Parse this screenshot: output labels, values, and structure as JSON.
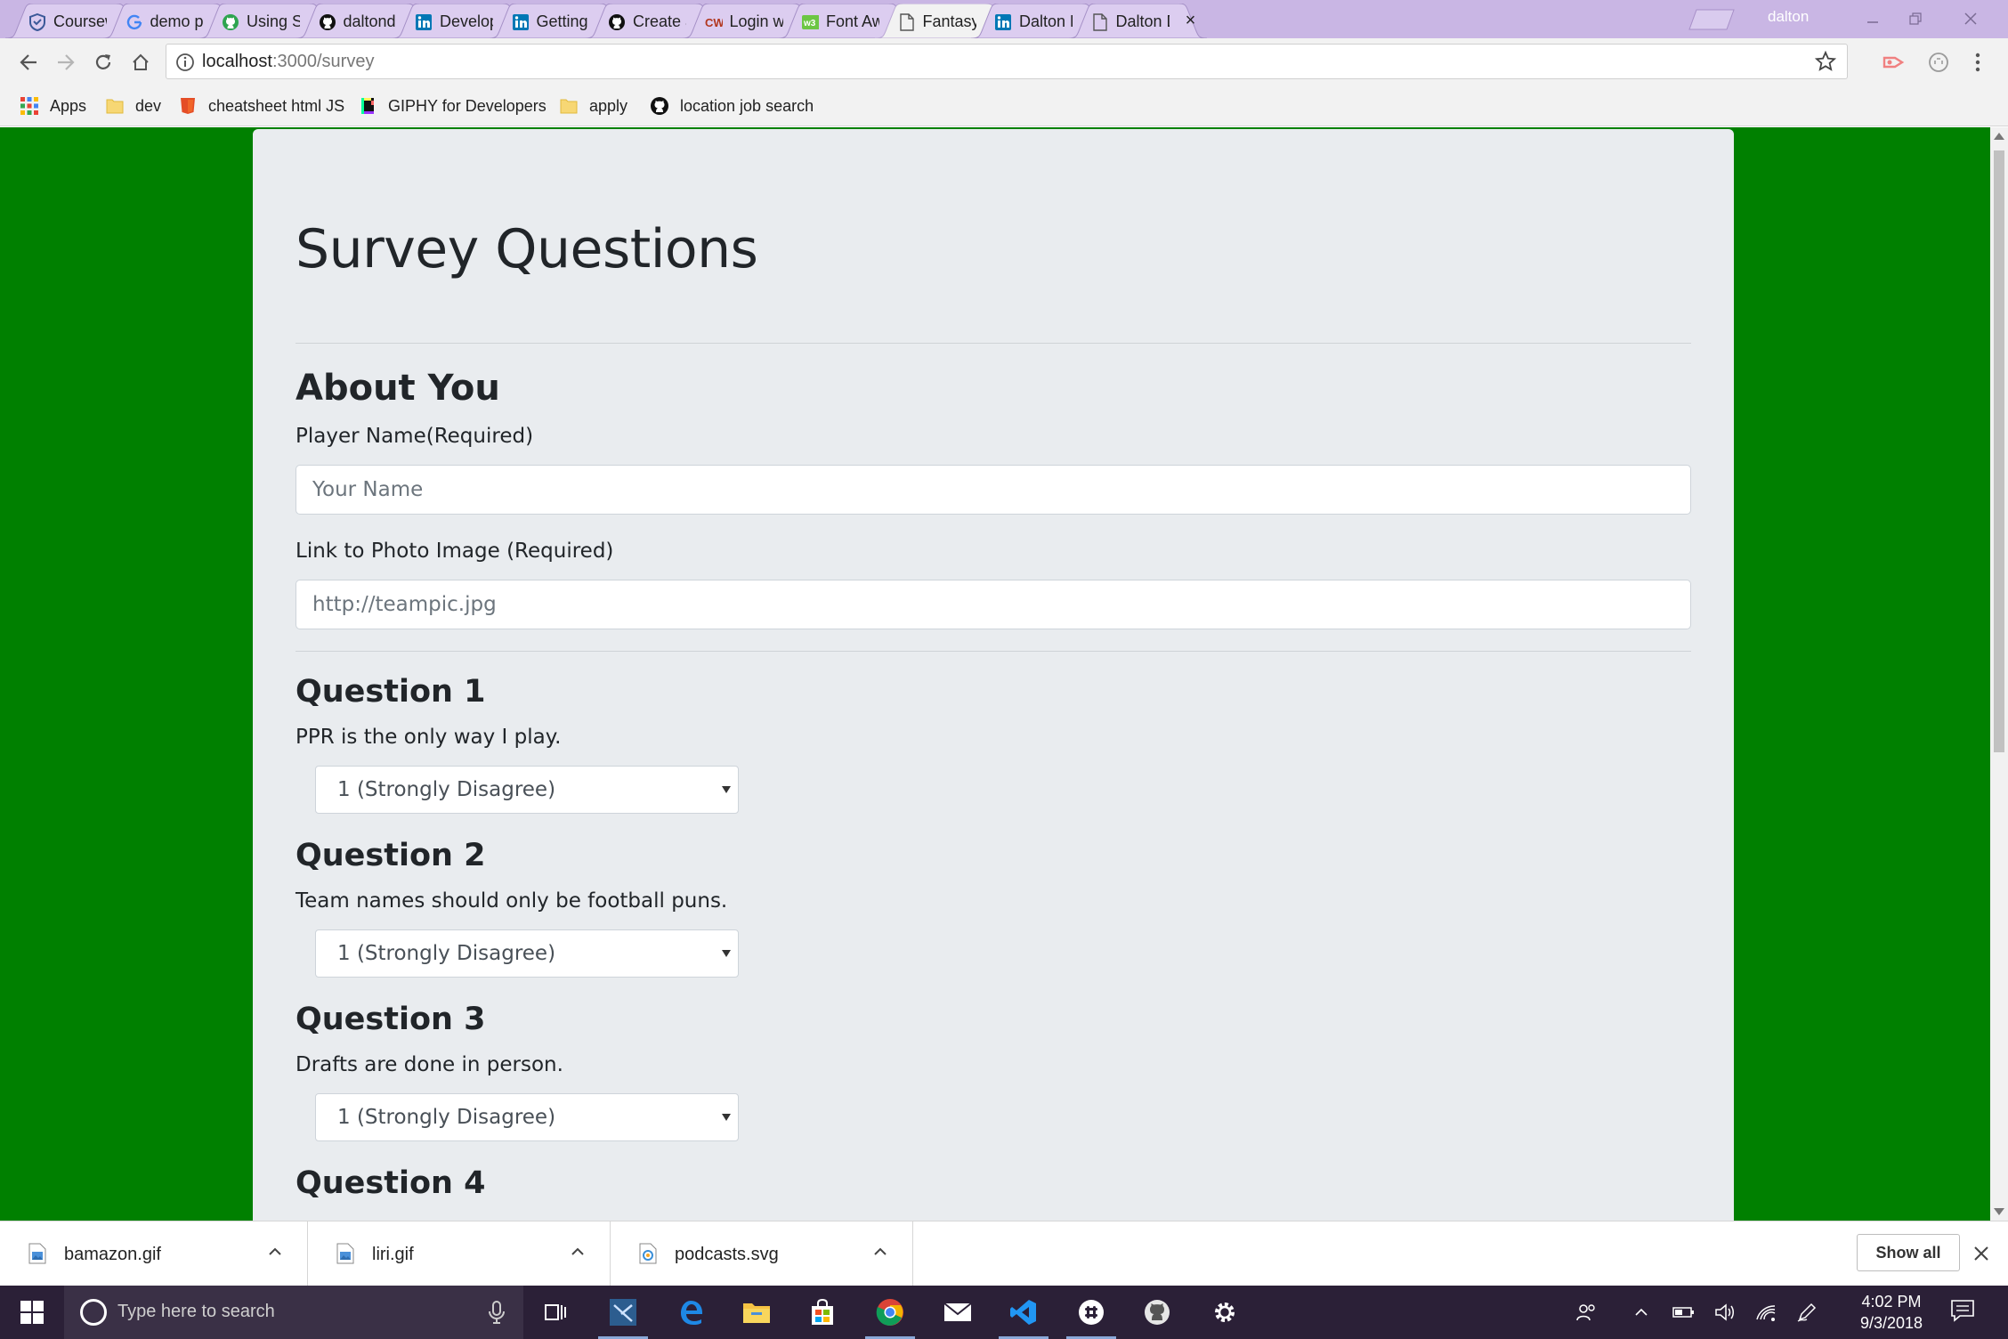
{
  "browser": {
    "tabs": [
      {
        "label": "Coursew",
        "icon": "shield-icon",
        "icon_color": "#3b5998"
      },
      {
        "label": "demo pi",
        "icon": "google-icon",
        "icon_color": "#4285f4"
      },
      {
        "label": "Using SC",
        "icon": "github-icon",
        "icon_color": "#2ea44f"
      },
      {
        "label": "daltond",
        "icon": "github-icon",
        "icon_color": "#111111"
      },
      {
        "label": "Develop",
        "icon": "linkedin-icon",
        "icon_color": "#0077b5"
      },
      {
        "label": "Getting",
        "icon": "linkedin-icon",
        "icon_color": "#0077b5"
      },
      {
        "label": "Create a",
        "icon": "github-icon",
        "icon_color": "#111111"
      },
      {
        "label": "Login wi",
        "icon": "codewars-icon",
        "icon_color": "#b1361e"
      },
      {
        "label": "Font Aw",
        "icon": "fontawesome-icon",
        "icon_color": "#6cc644"
      },
      {
        "label": "Fantasy",
        "icon": "page-icon",
        "icon_color": "#555555",
        "active": true
      },
      {
        "label": "Dalton D",
        "icon": "linkedin-icon",
        "icon_color": "#0077b5"
      },
      {
        "label": "Dalton D",
        "icon": "page-icon",
        "icon_color": "#555555"
      }
    ],
    "profile_name": "dalton",
    "url_host": "localhost",
    "url_path": ":3000/survey",
    "bookmarks": [
      {
        "label": "Apps",
        "icon": "apps-grid-icon"
      },
      {
        "label": "dev",
        "icon": "folder-icon"
      },
      {
        "label": "cheatsheet html JS",
        "icon": "html5-icon"
      },
      {
        "label": "GIPHY for Developers",
        "icon": "giphy-icon"
      },
      {
        "label": "apply",
        "icon": "folder-icon"
      },
      {
        "label": "location job search",
        "icon": "github-icon"
      }
    ]
  },
  "page": {
    "title": "Survey Questions",
    "about_heading": "About You",
    "name_label": "Player Name(Required)",
    "name_placeholder": "Your Name",
    "photo_label": "Link to Photo Image (Required)",
    "photo_placeholder": "http://teampic.jpg",
    "questions": [
      {
        "heading": "Question 1",
        "text": "PPR is the only way I play.",
        "selected": "1 (Strongly Disagree)"
      },
      {
        "heading": "Question 2",
        "text": "Team names should only be football puns.",
        "selected": "1 (Strongly Disagree)"
      },
      {
        "heading": "Question 3",
        "text": "Drafts are done in person.",
        "selected": "1 (Strongly Disagree)"
      },
      {
        "heading": "Question 4",
        "text": "",
        "selected": ""
      }
    ],
    "background_color": "#008000",
    "container_color": "#e9ecef"
  },
  "downloads": {
    "items": [
      {
        "name": "bamazon.gif",
        "icon": "image-file-icon"
      },
      {
        "name": "liri.gif",
        "icon": "image-file-icon"
      },
      {
        "name": "podcasts.svg",
        "icon": "svg-file-icon"
      }
    ],
    "show_all_label": "Show all"
  },
  "taskbar": {
    "search_placeholder": "Type here to search",
    "time": "4:02 PM",
    "date": "9/3/2018"
  }
}
